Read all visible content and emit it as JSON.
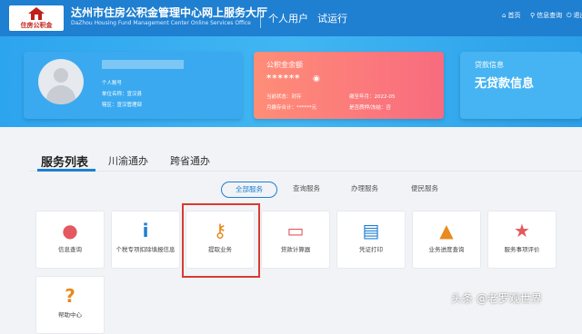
{
  "header": {
    "logo_text": "住房公积金",
    "title": "达州市住房公积金管理中心网上服务大厅",
    "subtitle": "DaZhou Housing Fund Management Center Online Services Office",
    "nav": [
      "个人用户",
      "试运行"
    ],
    "links": [
      {
        "label": "首页",
        "icon": "home-icon"
      },
      {
        "label": "信息查询",
        "icon": "search-icon"
      },
      {
        "label": "退出",
        "icon": "logout-icon"
      }
    ]
  },
  "user_card": {
    "account_label": "个人账号",
    "unit_label": "单位名称：宣汉县",
    "branch_label": "辖区：宣汉管理部"
  },
  "fund_card": {
    "title": "公积金余额",
    "amount": "******",
    "status": "当前状态：封存",
    "paid_until": "缴至年月：2022-05",
    "monthly": "月缴存合计：******元",
    "frozen": "是否质押/冻结：否"
  },
  "loan_card": {
    "title": "贷款信息",
    "status": "无贷款信息"
  },
  "tabs": [
    "服务列表",
    "川渝通办",
    "跨省通办"
  ],
  "filters": [
    "全部服务",
    "查询服务",
    "办理服务",
    "便民服务"
  ],
  "tiles": [
    {
      "label": "信息查询",
      "icon": "user-icon",
      "glyph": "●",
      "color": "#e4585f"
    },
    {
      "label": "个税专项扣除填报信息",
      "icon": "info-icon",
      "glyph": "i",
      "color": "#1f7fd1"
    },
    {
      "label": "提取业务",
      "icon": "key-icon",
      "glyph": "⚷",
      "color": "#e88a1e"
    },
    {
      "label": "贷款计算器",
      "icon": "document-icon",
      "glyph": "▭",
      "color": "#e4585f"
    },
    {
      "label": "凭证打印",
      "icon": "printer-icon",
      "glyph": "▤",
      "color": "#1f7fd1"
    },
    {
      "label": "业务进度查询",
      "icon": "road-icon",
      "glyph": "▲",
      "color": "#e88a1e"
    },
    {
      "label": "服务事项评价",
      "icon": "star-icon",
      "glyph": "★",
      "color": "#e4585f"
    },
    {
      "label": "帮助中心",
      "icon": "help-icon",
      "glyph": "?",
      "color": "#e88a1e"
    }
  ],
  "watermark": "头条 @老罗观世界",
  "colors": {
    "primary": "#1f7fd1",
    "accent_red": "#e4585f",
    "accent_orange": "#e88a1e",
    "highlight": "#d93b30"
  }
}
